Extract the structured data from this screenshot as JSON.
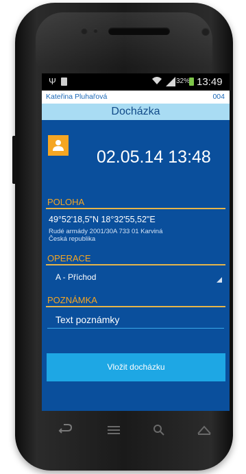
{
  "statusbar": {
    "battery_percent": "32%",
    "time": "13:49"
  },
  "user": {
    "name": "Kateřina Pluhařová",
    "code": "004"
  },
  "title": "Docházka",
  "datetime": "02.05.14 13:48",
  "location": {
    "label": "POLOHA",
    "coordinates": "49°52'18,5\"N 18°32'55,52\"E",
    "address_line1": "Rudé armády 2001/30A 733 01 Karviná",
    "address_line2": "Česká republika"
  },
  "operation": {
    "label": "OPERACE",
    "selected": "A - Příchod"
  },
  "note": {
    "label": "POZNÁMKA",
    "value": "Text poznámky"
  },
  "submit_label": "Vložit docházku",
  "colors": {
    "screen_bg": "#0a4f9c",
    "accent_orange": "#f5a623",
    "title_bar": "#a9dcf3",
    "button": "#1ea7e4"
  },
  "icons": {
    "avatar": "person-icon",
    "nav": [
      "back-icon",
      "menu-icon",
      "search-icon",
      "home-icon"
    ]
  }
}
